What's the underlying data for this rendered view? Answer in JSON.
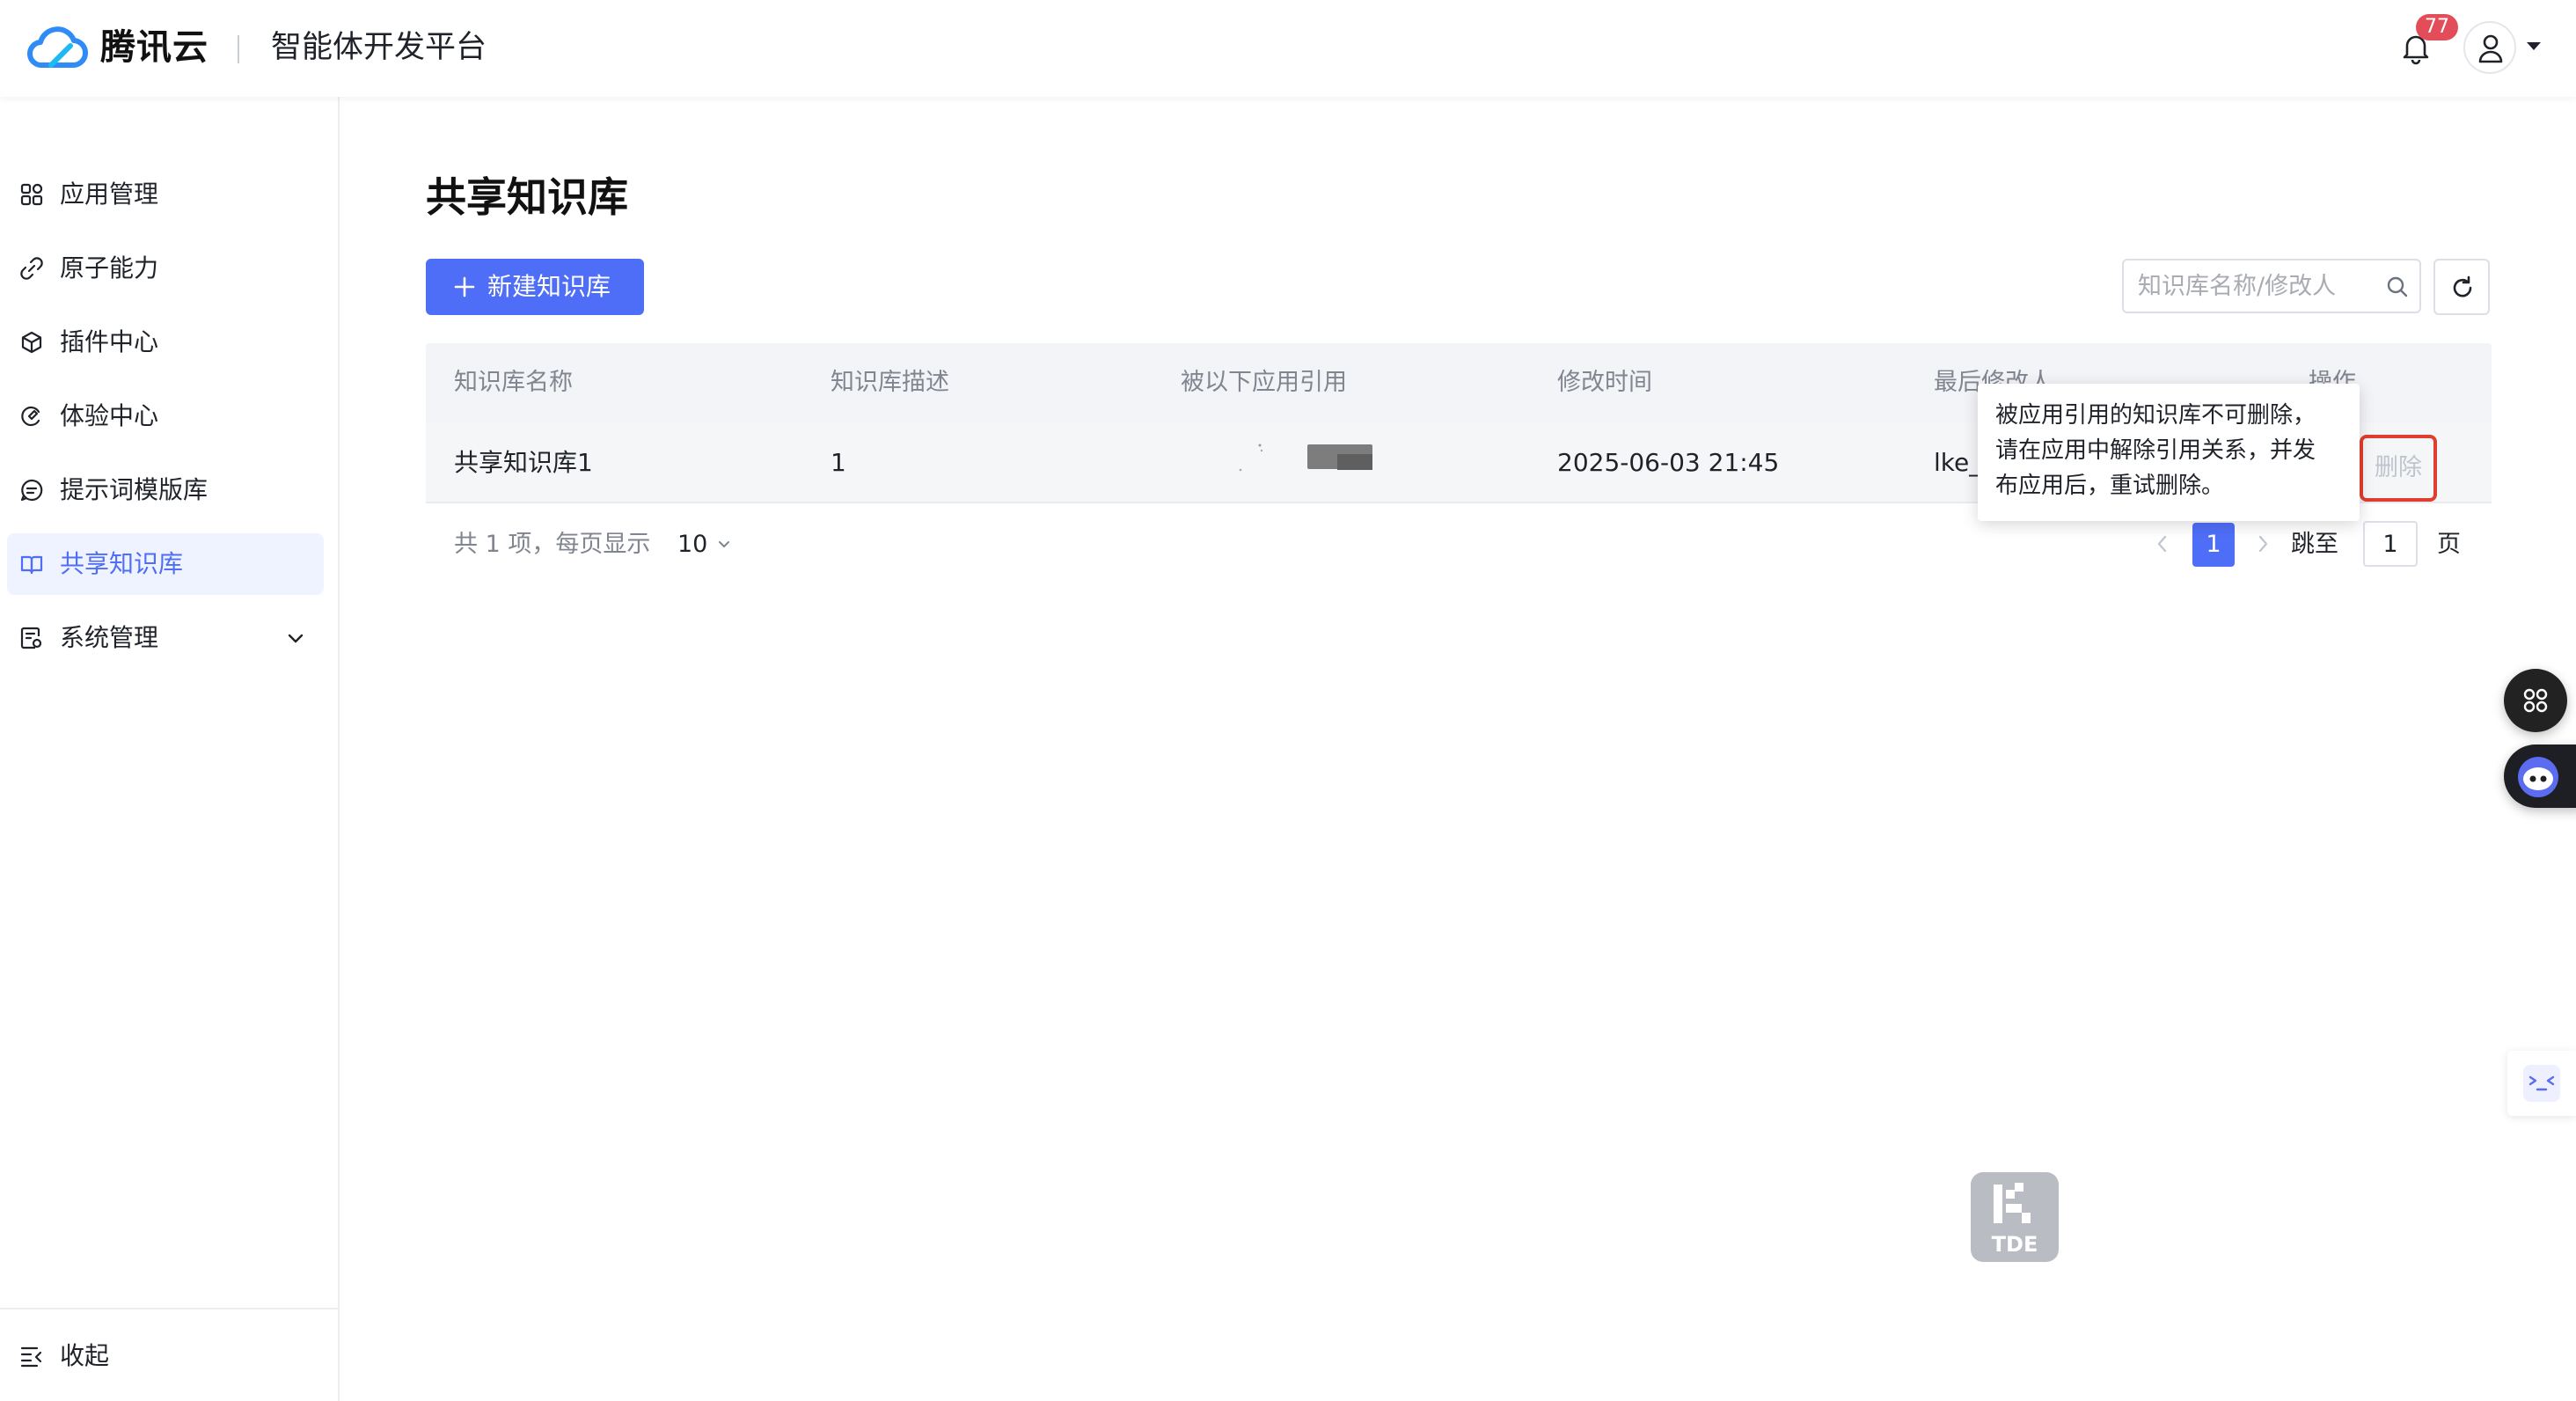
{
  "header": {
    "brand": "腾讯云",
    "platform": "智能体开发平台",
    "notification_count": "77"
  },
  "sidebar": {
    "items": [
      {
        "label": "应用管理",
        "icon": "apps-grid-icon"
      },
      {
        "label": "原子能力",
        "icon": "link-icon"
      },
      {
        "label": "插件中心",
        "icon": "cube-icon"
      },
      {
        "label": "体验中心",
        "icon": "experience-icon"
      },
      {
        "label": "提示词模版库",
        "icon": "chat-icon"
      },
      {
        "label": "共享知识库",
        "icon": "book-icon",
        "active": true
      },
      {
        "label": "系统管理",
        "icon": "settings-doc-icon",
        "expandable": true
      }
    ],
    "collapse_label": "收起"
  },
  "main": {
    "title": "共享知识库",
    "new_button_label": "新建知识库",
    "search_placeholder": "知识库名称/修改人",
    "table": {
      "columns": [
        "知识库名称",
        "知识库描述",
        "被以下应用引用",
        "修改时间",
        "最后修改人",
        "操作"
      ],
      "rows": [
        {
          "name": "共享知识库1",
          "description": "1",
          "referenced_by": "",
          "modified_time": "2025-06-03 21:45",
          "modifier": "lke_",
          "action": "删除"
        }
      ]
    },
    "tooltip_lines": [
      "被应用引用的知识库不可删除，",
      "请在应用中解除引用关系，并发",
      "布应用后，重试删除。"
    ],
    "pagination": {
      "total_text": "共 1 项，每页显示",
      "page_size": "10",
      "current_page": "1",
      "jump_label": "跳至",
      "jump_value": "1",
      "page_unit": "页"
    }
  },
  "colors": {
    "primary": "#4f6ef7",
    "badge": "#e34d59",
    "highlight_border": "#e03e2e"
  }
}
